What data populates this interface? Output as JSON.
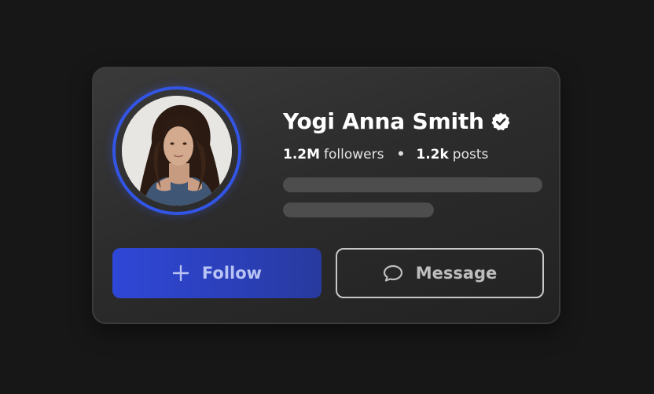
{
  "profile": {
    "name": "Yogi Anna Smith",
    "verified_icon": "verified-badge-icon",
    "followers_count": "1.2M",
    "followers_label": "followers",
    "separator": "•",
    "posts_count": "1.2k",
    "posts_label": "posts"
  },
  "actions": {
    "follow_label": "Follow",
    "follow_icon": "plus-icon",
    "message_label": "Message",
    "message_icon": "chat-bubble-icon"
  },
  "colors": {
    "background": "#171717",
    "accent": "#3355e6",
    "follow_button": "#2f47d6"
  }
}
